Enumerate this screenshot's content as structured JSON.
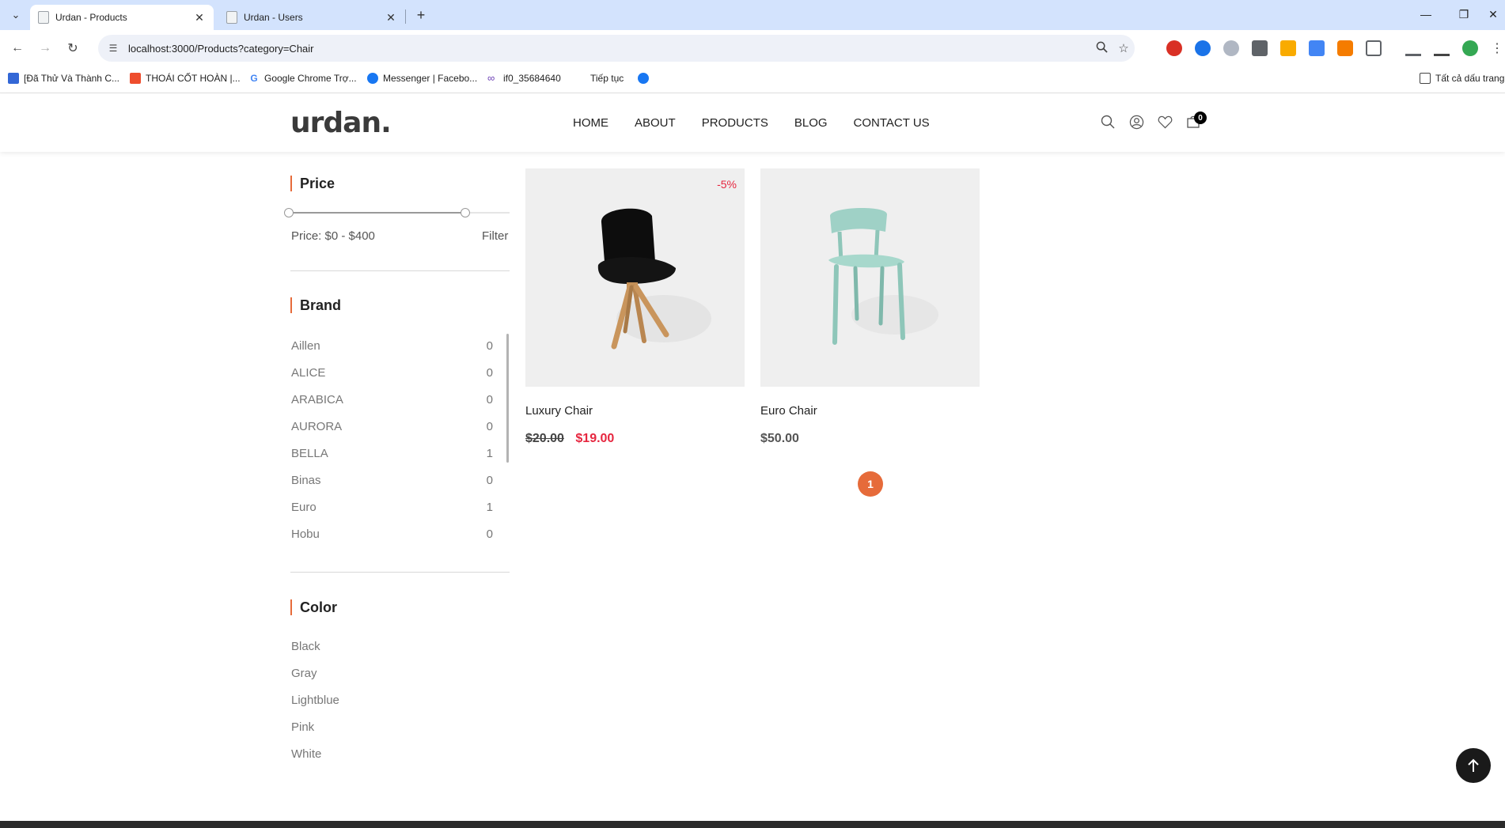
{
  "browser": {
    "tabs": [
      {
        "title": "Urdan - Products",
        "active": true
      },
      {
        "title": "Urdan - Users",
        "active": false
      }
    ],
    "url": "localhost:3000/Products?category=Chair",
    "bookmarks": [
      "[Đã Thử Và Thành C...",
      "THOÁI CỐT HOÀN |...",
      "Google Chrome Trợ...",
      "Messenger | Facebo...",
      "if0_35684640",
      "Tiếp tục"
    ],
    "all_bookmarks": "Tất cả dấu trang"
  },
  "header": {
    "logo": "urdan.",
    "nav": [
      "HOME",
      "ABOUT",
      "PRODUCTS",
      "BLOG",
      "CONTACT US"
    ],
    "cart_count": "0"
  },
  "sidebar": {
    "price": {
      "title": "Price",
      "label": "Price: $0 - $400",
      "filter": "Filter",
      "range_fraction": [
        0.0,
        0.8
      ]
    },
    "brand": {
      "title": "Brand",
      "items": [
        {
          "name": "Aillen",
          "count": "0"
        },
        {
          "name": "ALICE",
          "count": "0"
        },
        {
          "name": "ARABICA",
          "count": "0"
        },
        {
          "name": "AURORA",
          "count": "0"
        },
        {
          "name": "BELLA",
          "count": "1"
        },
        {
          "name": "Binas",
          "count": "0"
        },
        {
          "name": "Euro",
          "count": "1"
        },
        {
          "name": "Hobu",
          "count": "0"
        }
      ]
    },
    "color": {
      "title": "Color",
      "items": [
        "Black",
        "Gray",
        "Lightblue",
        "Pink",
        "White"
      ]
    }
  },
  "products": [
    {
      "name": "Luxury Chair",
      "badge": "-5%",
      "old_price": "$20.00",
      "price": "$19.00"
    },
    {
      "name": "Euro Chair",
      "badge": "",
      "old_price": "",
      "price": "$50.00"
    }
  ],
  "pagination": {
    "current": "1"
  },
  "colors": {
    "accent": "#e66b3a",
    "sale": "#e6263f",
    "tabbar": "#d3e3fd"
  }
}
